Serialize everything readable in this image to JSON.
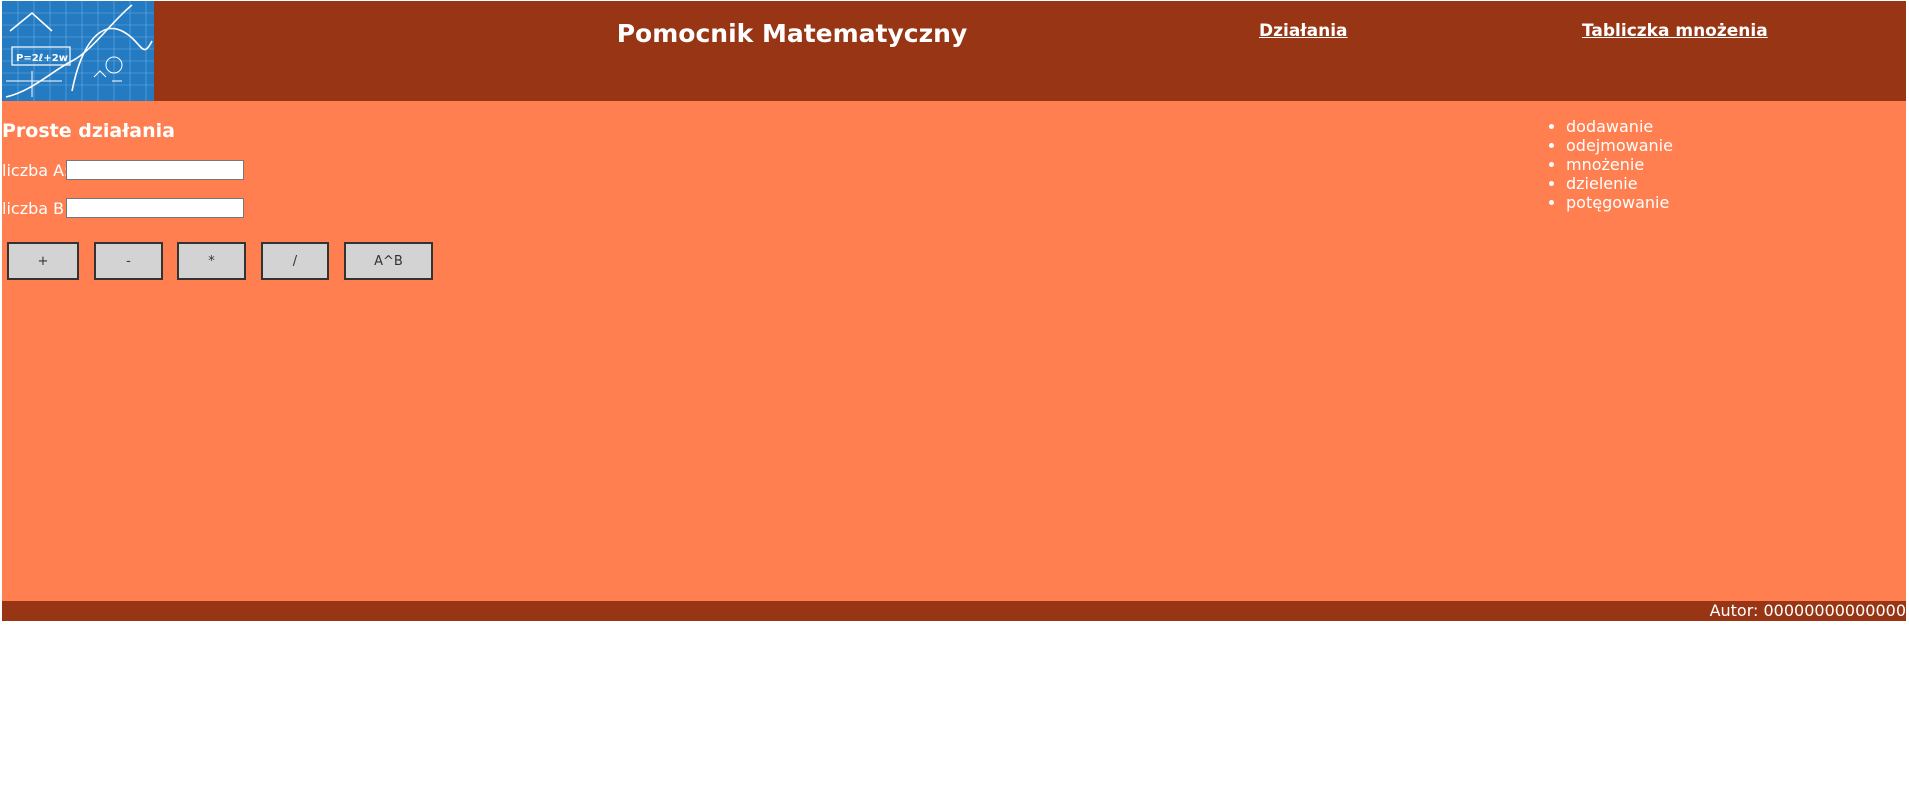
{
  "header": {
    "title": "Pomocnik Matematyczny",
    "logo_formula": "P=2ℓ+2w",
    "nav": [
      {
        "label": "Działania"
      },
      {
        "label": "Tabliczka mnożenia"
      }
    ]
  },
  "main": {
    "section_title": "Proste działania",
    "field_a": {
      "label": "liczba A:",
      "value": "",
      "placeholder": ""
    },
    "field_b": {
      "label": "liczba B:",
      "value": "",
      "placeholder": ""
    },
    "buttons": [
      "+",
      "-",
      "*",
      "/",
      "A^B"
    ],
    "operations_list": [
      "dodawanie",
      "odejmowanie",
      "mnożenie",
      "dzielenie",
      "potęgowanie"
    ]
  },
  "footer": {
    "author": "Autor: 00000000000000"
  },
  "colors": {
    "header_bg": "#973514",
    "main_bg": "#ff7f50",
    "footer_bg": "#973514",
    "button_bg": "#d3d3d3",
    "logo_bg": "#1a6cb4"
  }
}
